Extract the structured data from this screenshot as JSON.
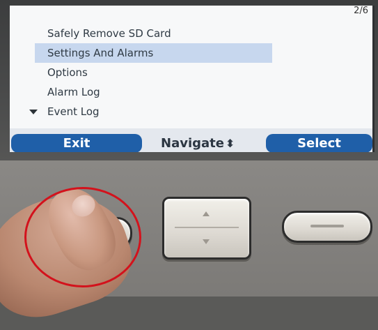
{
  "screen": {
    "page_counter": "2/6",
    "menu": {
      "items": [
        {
          "label": "Safely Remove SD Card",
          "selected": false
        },
        {
          "label": "Settings And Alarms",
          "selected": true
        },
        {
          "label": "Options",
          "selected": false
        },
        {
          "label": "Alarm Log",
          "selected": false
        },
        {
          "label": "Event Log",
          "selected": false
        }
      ]
    },
    "softkeys": {
      "exit": "Exit",
      "navigate": "Navigate",
      "select": "Select"
    }
  },
  "colors": {
    "softkey_blue": "#1f5fa8",
    "selection_highlight": "#c7d7ee",
    "annotation_circle": "#d3121c"
  },
  "icons": {
    "navigate": "up-down-arrows-icon",
    "more_below": "down-arrow-icon"
  }
}
